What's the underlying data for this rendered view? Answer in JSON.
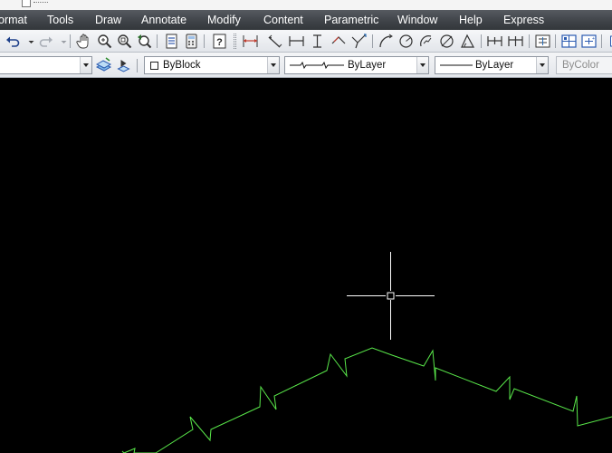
{
  "menubar": {
    "items": [
      {
        "label": "ormat"
      },
      {
        "label": "Tools"
      },
      {
        "label": "Draw"
      },
      {
        "label": "Annotate"
      },
      {
        "label": "Modify"
      },
      {
        "label": "Content"
      },
      {
        "label": "Parametric"
      },
      {
        "label": "Window"
      },
      {
        "label": "Help"
      },
      {
        "label": "Express"
      }
    ]
  },
  "properties": {
    "color": "ByBlock",
    "linetype": "ByLayer",
    "lineweight": "ByLayer",
    "plot_style": "ByColor"
  },
  "colors": {
    "canvas_background": "#000000",
    "drawing_line": "#59e84a",
    "crosshair": "#ffffff",
    "menubar": "#404449"
  },
  "icons": {
    "toolbar": [
      "undo-icon",
      "redo-icon",
      "pan-icon",
      "zoom-realtime-icon",
      "zoom-window-icon",
      "zoom-previous-icon",
      "properties-icon",
      "calculator-icon",
      "help-icon",
      "dim-linear-icon",
      "dim-aligned-icon",
      "dim-baseline-icon",
      "dim-ordinate-icon",
      "dim-angular-icon",
      "dim-jogged-icon",
      "dim-arc-icon",
      "dim-radius-icon",
      "dim-jog-radius-icon",
      "dim-diameter-icon",
      "dim-angle-icon",
      "dim-quick-icon",
      "dim-continue-icon",
      "dim-space-icon",
      "tolerance-icon",
      "center-mark-icon"
    ]
  }
}
